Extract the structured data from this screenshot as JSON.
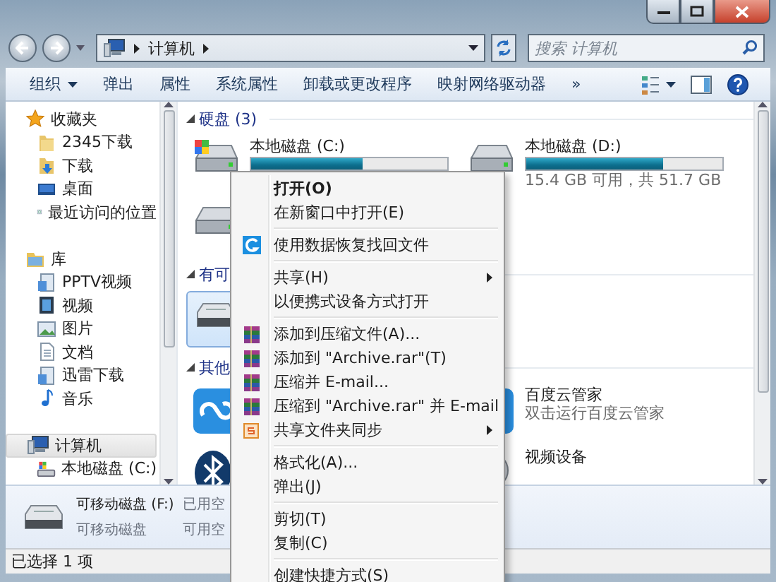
{
  "address_bar": {
    "path": [
      "计算机"
    ]
  },
  "search": {
    "placeholder": "搜索 计算机"
  },
  "toolbar": {
    "items": [
      {
        "label": "组织",
        "kind": "menu"
      },
      {
        "label": "弹出",
        "kind": "button"
      },
      {
        "label": "属性",
        "kind": "button"
      },
      {
        "label": "系统属性",
        "kind": "button"
      },
      {
        "label": "卸载或更改程序",
        "kind": "button"
      },
      {
        "label": "映射网络驱动器",
        "kind": "button"
      }
    ],
    "more": "»"
  },
  "sidebar": {
    "groups": [
      {
        "label": "收藏夹",
        "selected": false,
        "children": [
          {
            "label": "2345下载",
            "selected": false
          },
          {
            "label": "下载",
            "selected": false
          },
          {
            "label": "桌面",
            "selected": false
          },
          {
            "label": "最近访问的位置",
            "selected": false
          }
        ]
      },
      {
        "label": "库",
        "selected": false,
        "children": [
          {
            "label": "PPTV视频",
            "selected": false
          },
          {
            "label": "视频",
            "selected": false
          },
          {
            "label": "图片",
            "selected": false
          },
          {
            "label": "文档",
            "selected": false
          },
          {
            "label": "迅雷下载",
            "selected": false
          },
          {
            "label": "音乐",
            "selected": false
          }
        ]
      },
      {
        "label": "计算机",
        "selected": true,
        "children": [
          {
            "label": "本地磁盘 (C:)",
            "selected": false
          }
        ]
      }
    ]
  },
  "content": {
    "sections": [
      {
        "title": "硬盘 (3)",
        "expanded": true,
        "items": [
          {
            "kind": "drive",
            "name": "本地磁盘 (C:)",
            "level": 0.57,
            "selected": false
          },
          {
            "kind": "drive",
            "name": "本地磁盘 (D:)",
            "level": 0.7,
            "caption": "15.4 GB 可用，共 51.7 GB",
            "selected": false
          },
          {
            "kind": "drive",
            "selected": false
          }
        ]
      },
      {
        "title": "有可",
        "expanded": true,
        "items": [
          {
            "kind": "device",
            "selected": true
          }
        ]
      },
      {
        "title": "其他",
        "expanded": true,
        "items": [
          {
            "kind": "device",
            "selected": false
          },
          {
            "kind": "device",
            "name": "百度云管家",
            "caption": "双击运行百度云管家",
            "selected": false
          },
          {
            "kind": "device",
            "selected": false
          },
          {
            "kind": "device",
            "name": "视频设备",
            "selected": false
          }
        ]
      }
    ]
  },
  "details": {
    "name": "可移动磁盘 (F:)",
    "type": "可移动磁盘",
    "fields": [
      "已用空",
      "可用空"
    ]
  },
  "status_bar": {
    "text": "已选择 1 项"
  },
  "context_menu": {
    "items": [
      {
        "kind": "item",
        "label": "打开(O)",
        "default": true
      },
      {
        "kind": "item",
        "label": "在新窗口中打开(E)"
      },
      {
        "kind": "separator"
      },
      {
        "kind": "item",
        "label": "使用数据恢复找回文件"
      },
      {
        "kind": "separator"
      },
      {
        "kind": "item",
        "label": "共享(H)",
        "submenu": true
      },
      {
        "kind": "item",
        "label": "以便携式设备方式打开"
      },
      {
        "kind": "separator"
      },
      {
        "kind": "item",
        "label": "添加到压缩文件(A)..."
      },
      {
        "kind": "item",
        "label": "添加到 \"Archive.rar\"(T)"
      },
      {
        "kind": "item",
        "label": "压缩并 E-mail..."
      },
      {
        "kind": "item",
        "label": "压缩到 \"Archive.rar\" 并 E-mail"
      },
      {
        "kind": "item",
        "label": "共享文件夹同步",
        "submenu": true
      },
      {
        "kind": "separator"
      },
      {
        "kind": "item",
        "label": "格式化(A)..."
      },
      {
        "kind": "item",
        "label": "弹出(J)"
      },
      {
        "kind": "separator"
      },
      {
        "kind": "item",
        "label": "剪切(T)"
      },
      {
        "kind": "item",
        "label": "复制(C)"
      },
      {
        "kind": "separator"
      },
      {
        "kind": "item",
        "label": "创建快捷方式(S)"
      }
    ]
  }
}
